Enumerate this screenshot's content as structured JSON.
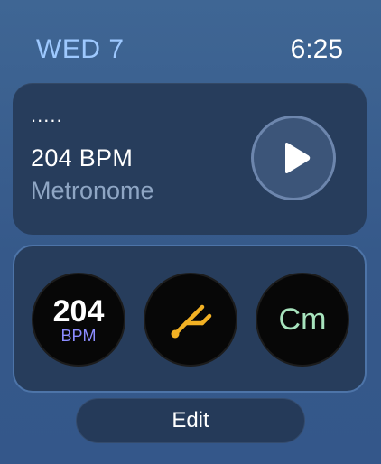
{
  "status": {
    "date": "WED 7",
    "time": "6:25"
  },
  "now_playing": {
    "dots": ".....",
    "title": "204 BPM",
    "subtitle": "Metronome",
    "play_icon": "play-icon"
  },
  "complications": {
    "bpm": {
      "value": "204",
      "unit": "BPM"
    },
    "tuner": {
      "icon": "tuning-fork-icon",
      "color": "#f2b124"
    },
    "key": {
      "label": "Cm",
      "color": "#a7e3bd"
    }
  },
  "edit": {
    "label": "Edit"
  },
  "colors": {
    "date": "#9ec9ff",
    "bpm_unit": "#8c8cff",
    "card": "#273d5c"
  }
}
